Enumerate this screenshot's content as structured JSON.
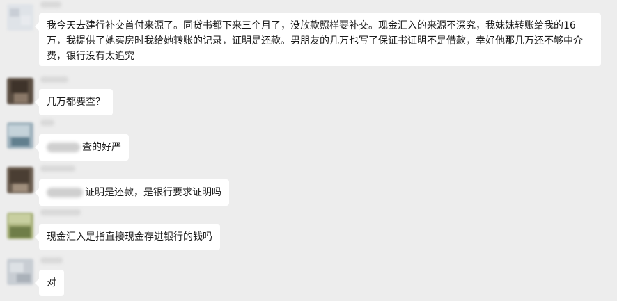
{
  "messages": [
    {
      "id": "m1",
      "text": "我今天去建行补交首付来源了。同贷书都下来三个月了，没放款照样要补交。现金汇入的来源不深究，我妹妹转账给我的16万，我提供了她买房时我给她转账的记录，证明是还款。男朋友的几万也写了保证书证明不是借款，幸好他那几万还不够中介费，银行没有太追究"
    },
    {
      "id": "m2",
      "text": "几万都要查？"
    },
    {
      "id": "m3",
      "text": "查的好严"
    },
    {
      "id": "m4",
      "text": "证明是还款，是银行要求证明吗"
    },
    {
      "id": "m5",
      "text": "现金汇入是指直接现金存进银行的钱吗"
    },
    {
      "id": "m6",
      "text": "对"
    }
  ],
  "colors": {
    "background": "#ededed",
    "bubble": "#ffffff",
    "text": "#1a1a1a"
  }
}
